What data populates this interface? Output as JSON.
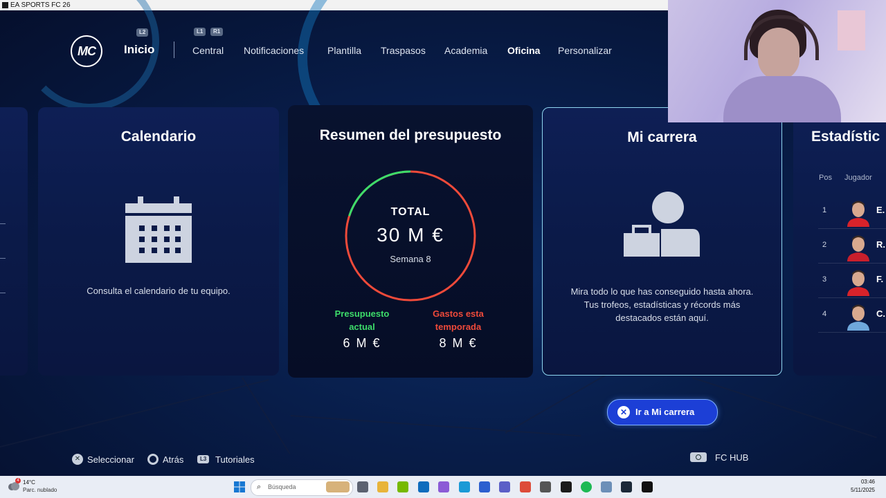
{
  "window": {
    "title": "EA SPORTS FC 26"
  },
  "header": {
    "logo_text": "MC",
    "hint_left": "L2",
    "hint_l1": "L1",
    "hint_r1": "R1",
    "home_label": "Inicio",
    "tabs": [
      {
        "label": "Central",
        "active": false
      },
      {
        "label": "Notificaciones",
        "active": false
      },
      {
        "label": "Plantilla",
        "active": false
      },
      {
        "label": "Traspasos",
        "active": false
      },
      {
        "label": "Academia",
        "active": false
      },
      {
        "label": "Oficina",
        "active": true
      },
      {
        "label": "Personalizar",
        "active": false
      }
    ]
  },
  "calendar_card": {
    "title": "Calendario",
    "description": "Consulta el calendario de tu equipo.",
    "icon": "calendar-icon"
  },
  "budget_card": {
    "title": "Resumen del presupuesto",
    "total_label": "TOTAL",
    "total_value": "30 M €",
    "week_label": "Semana  8",
    "current_fraction": 0.2,
    "current_label": "Presupuesto actual",
    "current_value": "6 M €",
    "spent_label": "Gastos esta temporada",
    "spent_value": "8 M €",
    "colors": {
      "current": "#3ddc6a",
      "spent": "#ef4a3a"
    }
  },
  "career_card": {
    "title": "Mi carrera",
    "description": "Mira todo lo que has conseguido hasta ahora. Tus trofeos, estadísticas y récords más destacados están aquí.",
    "icon": "career-icon"
  },
  "stats_card": {
    "title": "Estadístic",
    "col_pos": "Pos",
    "col_player": "Jugador",
    "rows": [
      {
        "pos": "1",
        "name": "E.",
        "shirt": "#d8232a"
      },
      {
        "pos": "2",
        "name": "R.",
        "shirt": "#c91f2c"
      },
      {
        "pos": "3",
        "name": "F.",
        "shirt": "#d8232a"
      },
      {
        "pos": "4",
        "name": "C.",
        "shirt": "#6fa8dc"
      }
    ]
  },
  "action": {
    "label": "Ir a Mi carrera",
    "button_icon": "cross-button-icon"
  },
  "footer": {
    "select_label": "Seleccionar",
    "back_label": "Atrás",
    "tutorials_label": "Tutoriales",
    "tutorials_hint": "L3",
    "hub_label": "FC HUB"
  },
  "taskbar": {
    "temperature": "14°C",
    "condition": "Parc. nublado",
    "weather_badge": "4",
    "search_placeholder": "Búsqueda",
    "time": "03:46",
    "date": "5/11/2025"
  }
}
